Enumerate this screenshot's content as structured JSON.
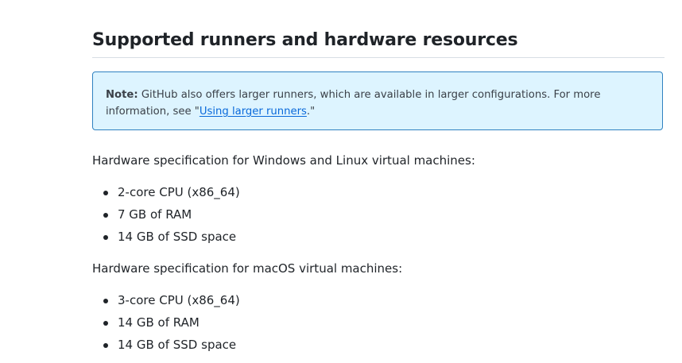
{
  "section": {
    "title": "Supported runners and hardware resources"
  },
  "note": {
    "label": "Note:",
    "text_before_link": " GitHub also offers larger runners, which are available in larger configurations. For more information, see \"",
    "link_text": "Using larger runners",
    "text_after_link": ".\""
  },
  "windows_linux": {
    "heading": "Hardware specification for Windows and Linux virtual machines:",
    "items": [
      "2-core CPU (x86_64)",
      "7 GB of RAM",
      "14 GB of SSD space"
    ]
  },
  "macos": {
    "heading": "Hardware specification for macOS virtual machines:",
    "items": [
      "3-core CPU (x86_64)",
      "14 GB of RAM",
      "14 GB of SSD space"
    ]
  },
  "colors": {
    "note_background": "#ddf4ff",
    "note_border": "#2f81c0",
    "link": "#0969da",
    "text": "#1f2328"
  }
}
